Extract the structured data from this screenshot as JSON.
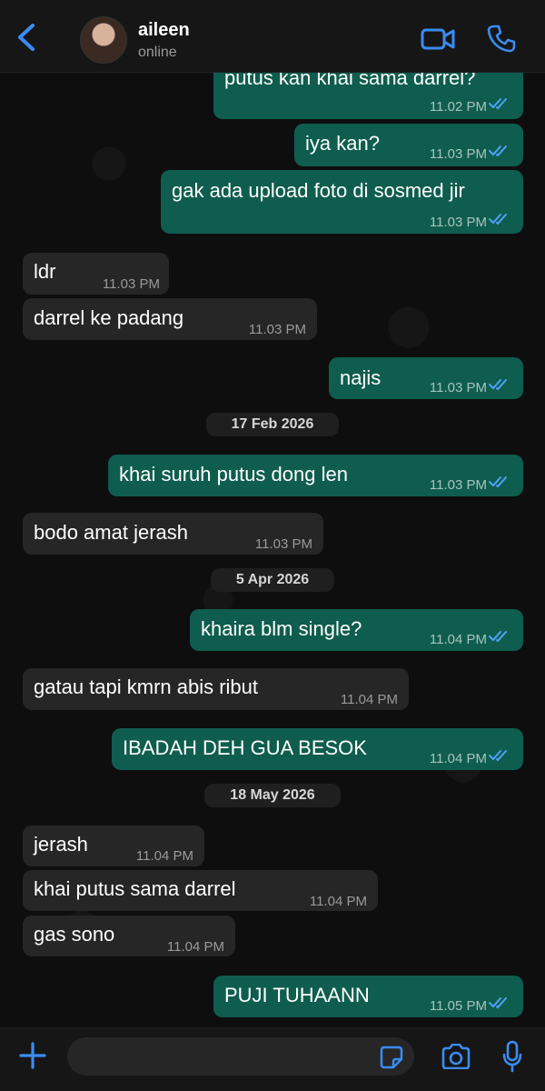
{
  "header": {
    "contact_name": "aileen",
    "contact_status": "online"
  },
  "messages": [
    {
      "dir": "out",
      "text": "putus kan khai sama darrel?",
      "time": "11.02 PM"
    },
    {
      "dir": "out",
      "text": "iya kan?",
      "time": "11.03 PM"
    },
    {
      "dir": "out",
      "text": "gak ada upload foto di sosmed jir",
      "time": "11.03 PM"
    },
    {
      "dir": "in",
      "text": "ldr",
      "time": "11.03 PM"
    },
    {
      "dir": "in",
      "text": "darrel ke padang",
      "time": "11.03 PM"
    },
    {
      "dir": "out",
      "text": "najis",
      "time": "11.03 PM"
    },
    {
      "dir": "out",
      "text": "khai suruh putus dong len",
      "time": "11.03 PM"
    },
    {
      "dir": "in",
      "text": "bodo amat jerash",
      "time": "11.03 PM"
    },
    {
      "dir": "out",
      "text": "khaira blm single?",
      "time": "11.04 PM"
    },
    {
      "dir": "in",
      "text": "gatau tapi kmrn abis ribut",
      "time": "11.04 PM"
    },
    {
      "dir": "out",
      "text": "IBADAH DEH GUA BESOK",
      "time": "11.04 PM"
    },
    {
      "dir": "in",
      "text": "jerash",
      "time": "11.04 PM"
    },
    {
      "dir": "in",
      "text": "khai putus sama darrel",
      "time": "11.04 PM"
    },
    {
      "dir": "in",
      "text": "gas sono",
      "time": "11.04 PM"
    },
    {
      "dir": "out",
      "text": "PUJI TUHAANN",
      "time": "11.05 PM"
    }
  ],
  "dates": [
    "17 Feb 2026",
    "5 Apr 2026",
    "18 May 2026"
  ],
  "colors": {
    "accent": "#3b8cf3",
    "outgoing_bubble": "#0f5d4f",
    "incoming_bubble": "#262626",
    "read_ticks": "#4fa3f7"
  },
  "icons": {
    "back": "chevron-left-icon",
    "video": "video-call-icon",
    "call": "phone-icon",
    "attach": "plus-icon",
    "sticker": "sticker-icon",
    "camera": "camera-icon",
    "mic": "microphone-icon"
  }
}
